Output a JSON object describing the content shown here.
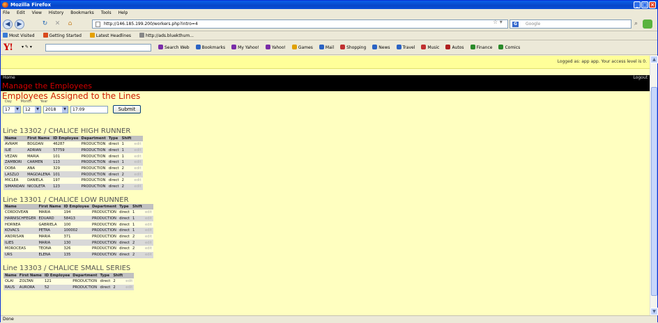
{
  "window": {
    "title": "Mozilla Firefox"
  },
  "menu": [
    "File",
    "Edit",
    "View",
    "History",
    "Bookmarks",
    "Tools",
    "Help"
  ],
  "nav": {
    "url": "http://146.185.199.200/workers.php?intro=4",
    "search_placeholder": "Google"
  },
  "bookmarks": [
    {
      "label": "Most Visited",
      "color": "#3a7bd5"
    },
    {
      "label": "Getting Started",
      "color": "#d94a1e"
    },
    {
      "label": "Latest Headlines",
      "color": "#e5a000"
    },
    {
      "label": "http://ads.bluekthum...",
      "color": "#888888"
    }
  ],
  "yahoo": {
    "logo": "Y!",
    "items": [
      "Search Web",
      "Bookmarks",
      "My Yahoo!",
      "Yahoo!",
      "Games",
      "Mail",
      "Shopping",
      "News",
      "Travel",
      "Music",
      "Autos",
      "Finance",
      "Comics"
    ]
  },
  "page": {
    "notice": "Logged as: app app. Your access level is 0.",
    "home": "Home",
    "logout": "Logout",
    "manage_title": "Manage the Employees",
    "main_title": "Employees Assigned to the Lines",
    "date_labels": [
      "Day",
      "Month",
      "Year"
    ],
    "date": {
      "day": "17",
      "month": "12",
      "year": "2018",
      "time": "17:09"
    },
    "submit": "Submit"
  },
  "lines": [
    {
      "title": "Line 13302 / CHALICE HIGH RUNNER",
      "headers": [
        "Name",
        "First Name",
        "ID Employee",
        "Department",
        "Type",
        "Shift",
        ""
      ],
      "rows": [
        [
          "AVRAM",
          "BOGDAN",
          "46287",
          "PRODUCTION",
          "direct",
          "1",
          "edit"
        ],
        [
          "ILIE",
          "ADRIAN",
          "57759",
          "PRODUCTION",
          "direct",
          "1",
          "edit"
        ],
        [
          "VEZAN",
          "MARIA",
          "101",
          "PRODUCTION",
          "direct",
          "1",
          "edit"
        ],
        [
          "ZAMBORI",
          "CARMEN",
          "113",
          "PRODUCTION",
          "direct",
          "1",
          "edit"
        ],
        [
          "DOBA",
          "ANA",
          "329",
          "PRODUCTION",
          "direct",
          "2",
          "edit"
        ],
        [
          "LASZLO",
          "MAGDALENA",
          "101",
          "PRODUCTION",
          "direct",
          "2",
          "edit"
        ],
        [
          "MICLEA",
          "DANIELA",
          "197",
          "PRODUCTION",
          "direct",
          "2",
          "edit"
        ],
        [
          "SIMANDAN",
          "NICOLETA",
          "123",
          "PRODUCTION",
          "direct",
          "2",
          "edit"
        ]
      ]
    },
    {
      "title": "Line 13301 / CHALICE LOW RUNNER",
      "headers": [
        "Name",
        "First Name",
        "ID Employee",
        "Department",
        "Type",
        "Shift",
        ""
      ],
      "rows": [
        [
          "CORDOVEAN",
          "MARIA",
          "194",
          "PRODUCTION",
          "direct",
          "1",
          "edit"
        ],
        [
          "HARNISCHFEGER",
          "EDUARD",
          "58413",
          "PRODUCTION",
          "direct",
          "1",
          "edit"
        ],
        [
          "HORNEA",
          "GABRIELA",
          "100",
          "PRODUCTION",
          "direct",
          "1",
          "edit"
        ],
        [
          "KOVACS",
          "PETRA",
          "100002",
          "PRODUCTION",
          "direct",
          "1",
          "edit"
        ],
        [
          "ANDRISAN",
          "MARIA",
          "371",
          "PRODUCTION",
          "direct",
          "2",
          "edit"
        ],
        [
          "ILIES",
          "MARIA",
          "130",
          "PRODUCTION",
          "direct",
          "2",
          "edit"
        ],
        [
          "MOROCEAS",
          "TEONA",
          "326",
          "PRODUCTION",
          "direct",
          "2",
          "edit"
        ],
        [
          "URS",
          "ELENA",
          "135",
          "PRODUCTION",
          "direct",
          "2",
          "edit"
        ]
      ]
    },
    {
      "title": "Line 13303 / CHALICE SMALL SERIES",
      "headers": [
        "Name",
        "First Name",
        "ID Employee",
        "Department",
        "Type",
        "Shift",
        ""
      ],
      "rows": [
        [
          "OLAI",
          "ZOLTAN",
          "121",
          "PRODUCTION",
          "direct",
          "2",
          "edit"
        ],
        [
          "RAUS",
          "AURORA",
          "52",
          "PRODUCTION",
          "direct",
          "2",
          "edit"
        ]
      ]
    }
  ],
  "status": {
    "text": "Done"
  }
}
